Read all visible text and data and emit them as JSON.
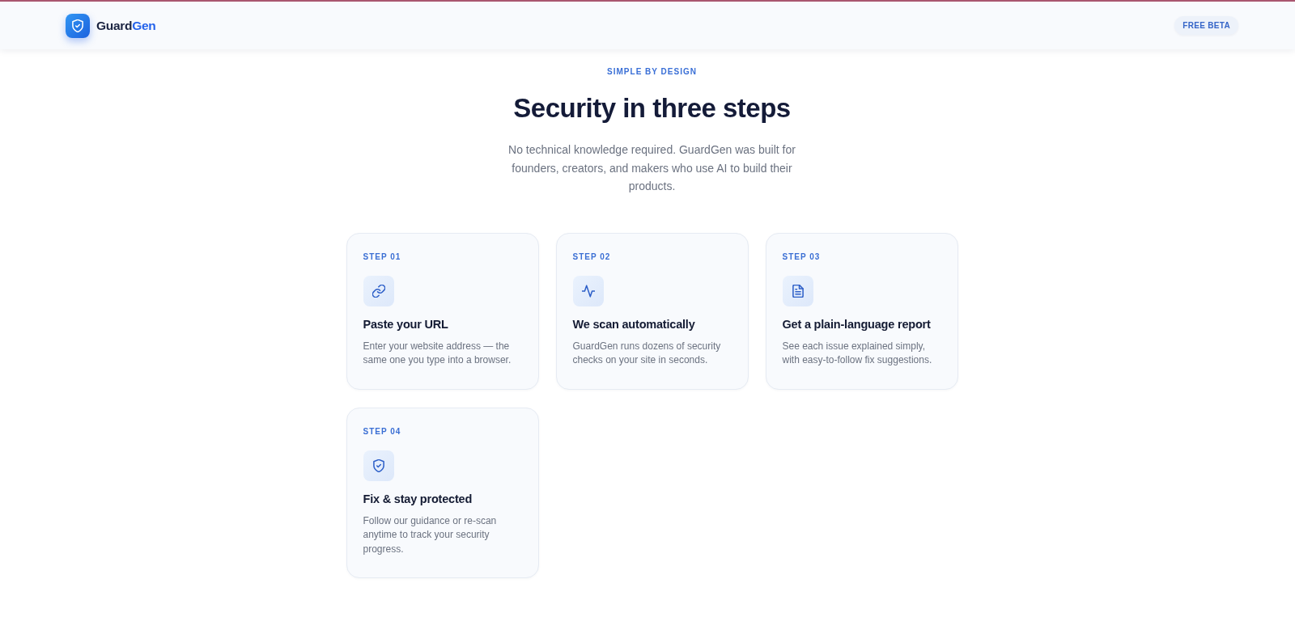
{
  "header": {
    "logo": {
      "name": "Guard",
      "name_accent": "Gen"
    },
    "badge": "FREE BETA"
  },
  "section": {
    "eyebrow": "SIMPLE BY DESIGN",
    "title": "Security in three steps",
    "description": "No technical knowledge required. GuardGen was built for founders, creators, and makers who use AI to build their products."
  },
  "steps": [
    {
      "kind": "link",
      "label": "STEP 01",
      "title": "Paste your URL",
      "description": "Enter your website address — the same one you type into a browser."
    },
    {
      "kind": "pulse",
      "label": "STEP 02",
      "title": "We scan automatically",
      "description": "GuardGen runs dozens of security checks on your site in seconds."
    },
    {
      "kind": "document",
      "label": "STEP 03",
      "title": "Get a plain-language report",
      "description": "See each issue explained simply, with easy-to-follow fix suggestions."
    },
    {
      "kind": "shield",
      "label": "STEP 04",
      "title": "Fix & stay protected",
      "description": "Follow our guidance or re-scan anytime to track your security progress."
    }
  ]
}
